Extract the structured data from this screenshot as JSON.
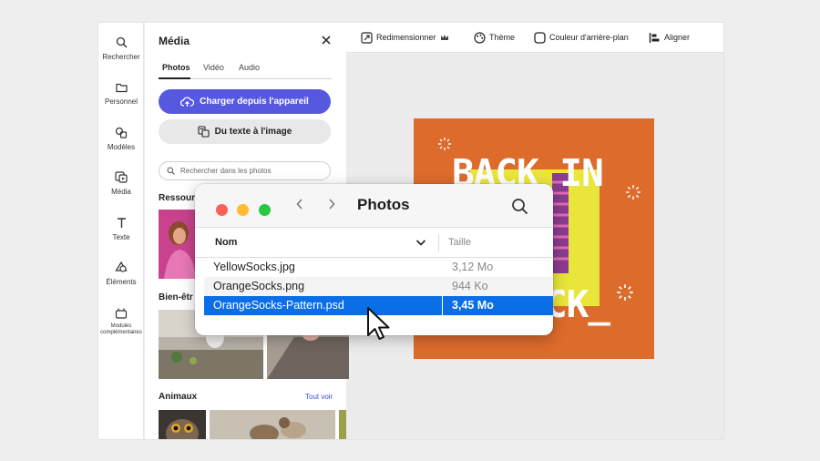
{
  "rail": {
    "items": [
      {
        "label": "Rechercher",
        "icon": "search-icon"
      },
      {
        "label": "Personnel",
        "icon": "folder-icon"
      },
      {
        "label": "Modèles",
        "icon": "templates-icon"
      },
      {
        "label": "Média",
        "icon": "media-icon"
      },
      {
        "label": "Texte",
        "icon": "text-icon"
      },
      {
        "label": "Éléments",
        "icon": "elements-icon"
      },
      {
        "label": "Modules complémentaires",
        "icon": "addons-icon"
      }
    ]
  },
  "panel": {
    "title": "Média",
    "tabs": [
      "Photos",
      "Vidéo",
      "Audio"
    ],
    "upload_button": "Charger depuis l'appareil",
    "text_to_image_button": "Du texte à l'image",
    "search_placeholder": "Rechercher dans les photos",
    "sections": [
      {
        "title": "Ressour"
      },
      {
        "title": "Bien-êtr"
      },
      {
        "title": "Animaux",
        "see_all": "Tout voir"
      }
    ]
  },
  "toolbar": {
    "resize": "Redimensionner",
    "theme": "Thème",
    "background": "Couleur d'arrière-plan",
    "align": "Aligner"
  },
  "canvas": {
    "line1": "BACK IN",
    "line2": "CK_",
    "bg_color": "#dd6b2c",
    "accent_color": "#e9e53b"
  },
  "finder": {
    "title": "Photos",
    "columns": {
      "name": "Nom",
      "size": "Taille"
    },
    "rows": [
      {
        "name": "YellowSocks.jpg",
        "size": "3,12 Mo",
        "selected": false
      },
      {
        "name": "OrangeSocks.png",
        "size": "944 Ko",
        "selected": false
      },
      {
        "name": "OrangeSocks-Pattern.psd",
        "size": "3,45 Mo",
        "selected": true
      }
    ],
    "selection_color": "#0a6ee6"
  }
}
